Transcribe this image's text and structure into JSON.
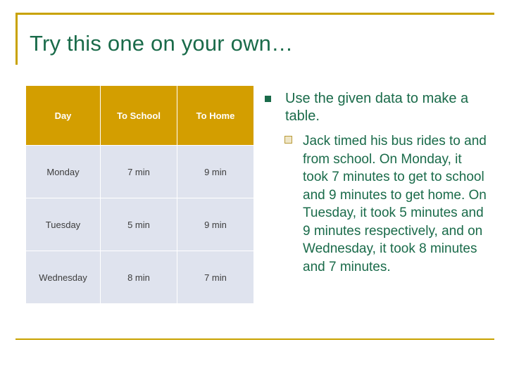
{
  "slide": {
    "title": "Try this one on your own…",
    "accent_color": "#c8a200",
    "title_color": "#1a6b4a",
    "header_fill": "#d39e00",
    "cell_fill": "#dfe3ee"
  },
  "table": {
    "headers": [
      "Day",
      "To School",
      "To Home"
    ],
    "rows": [
      [
        "Monday",
        "7 min",
        "9 min"
      ],
      [
        "Tuesday",
        "5 min",
        "9 min"
      ],
      [
        "Wednesday",
        "8 min",
        "7 min"
      ]
    ]
  },
  "bullets": {
    "level1": "Use the given data to make a table.",
    "level2": "Jack timed his bus rides to and from school. On Monday, it took 7 minutes to get to school and 9 minutes to get home. On Tuesday, it took 5 minutes and 9 minutes respectively, and on Wednesday, it took 8 minutes and 7 minutes."
  }
}
